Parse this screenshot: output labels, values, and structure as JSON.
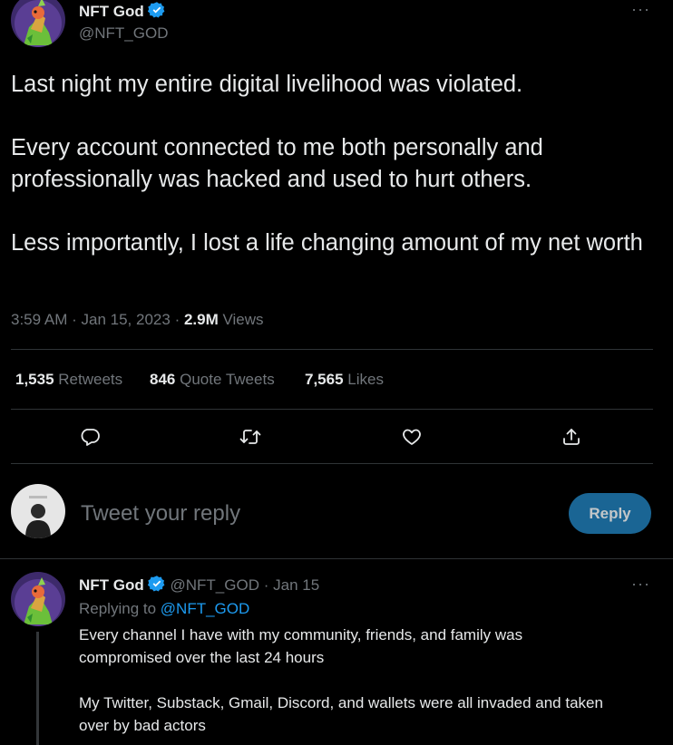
{
  "colors": {
    "background": "#000000",
    "text": "#e7e9ea",
    "muted": "#71767b",
    "accent": "#1d9bf0",
    "reply_button_bg": "#1a6594",
    "divider": "#2f3336"
  },
  "main_tweet": {
    "display_name": "NFT God",
    "handle": "@NFT_GOD",
    "avatar_icon": "nft-avatar-icon",
    "verified_icon": "verified-badge-icon",
    "more_icon": "more-dots-icon",
    "more_label": "···",
    "paragraphs": [
      "Last night my entire digital livelihood was violated.",
      "Every account connected to me both personally and professionally was hacked and used to hurt others.",
      "Less importantly, I lost a life changing amount of my net worth"
    ],
    "time": "3:59 AM",
    "separator": "·",
    "date": "Jan 15, 2023",
    "views_count": "2.9M",
    "views_label": "Views"
  },
  "stats": {
    "retweets_count": "1,535",
    "retweets_label": "Retweets",
    "quotes_count": "846",
    "quotes_label": "Quote Tweets",
    "likes_count": "7,565",
    "likes_label": "Likes"
  },
  "actions": [
    "reply-icon",
    "retweet-icon",
    "like-icon",
    "share-icon"
  ],
  "composer": {
    "placeholder": "Tweet your reply",
    "button_label": "Reply",
    "avatar_icon": "user-avatar-icon"
  },
  "reply_tweet": {
    "display_name": "NFT God",
    "handle": "@NFT_GOD",
    "separator": "·",
    "date": "Jan 15",
    "replying_to_label": "Replying to",
    "replying_to_handle": "@NFT_GOD",
    "more_label": "···",
    "paragraphs": [
      "Every channel I have with my community, friends, and family was compromised over the last 24 hours",
      "My Twitter, Substack, Gmail, Discord, and wallets were all invaded and taken over by bad actors"
    ]
  }
}
